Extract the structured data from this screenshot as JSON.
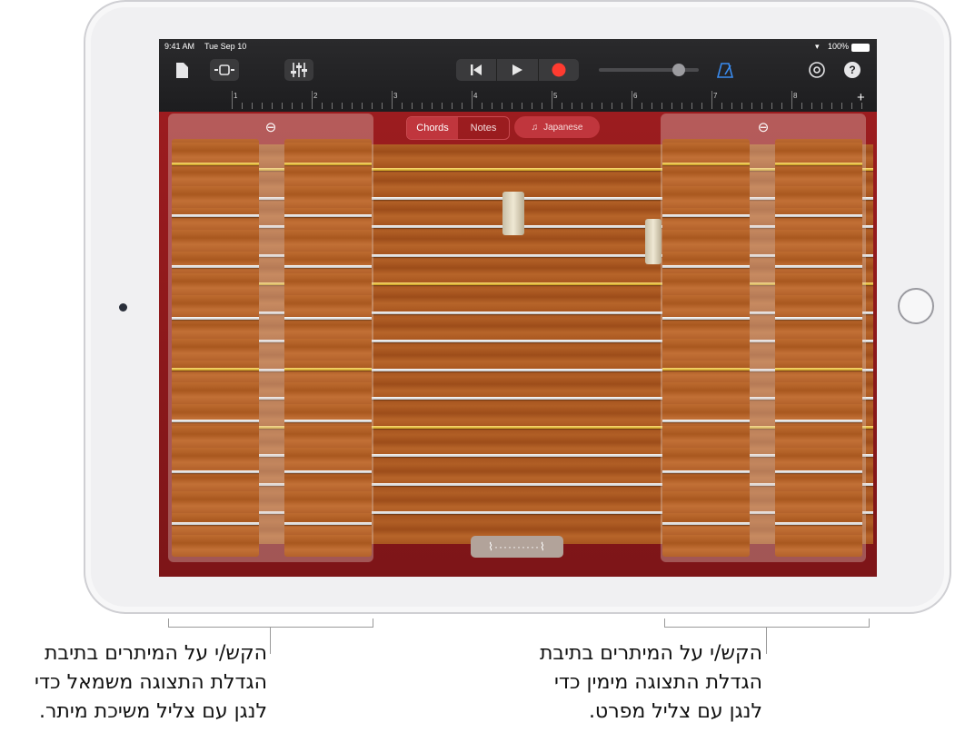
{
  "status_bar": {
    "time": "9:41 AM",
    "date": "Tue Sep 10",
    "battery": "100%"
  },
  "toolbar": {
    "icons": [
      "document-icon",
      "track-view-icon",
      "mixer-icon",
      "go-to-start-icon",
      "play-icon",
      "record-icon",
      "metronome-icon",
      "settings-icon",
      "help-icon"
    ],
    "help_label": "?",
    "volume_level": 0.8
  },
  "ruler": {
    "bars": [
      "1",
      "2",
      "3",
      "4",
      "5",
      "6",
      "7",
      "8"
    ],
    "add_label": "+"
  },
  "instrument": {
    "chords_label": "Chords",
    "notes_label": "Notes",
    "active_mode": "Notes",
    "scale_label": "Japanese",
    "vibrato_glyph": "⌇··········⌇",
    "zoom_icon": "zoom-out-icon",
    "colors": {
      "accent_red": "#c0363d",
      "gold_string": "#e0b13a"
    }
  },
  "callouts": {
    "left": [
      "הקש/י על המיתרים בתיבת",
      "הגדלת התצוגה משמאל כדי",
      "לנגן עם צליל משיכת מיתר."
    ],
    "right": [
      "הקש/י על המיתרים בתיבת",
      "הגדלת התצוגה מימין כדי",
      "לנגן עם צליל מפרט."
    ]
  }
}
